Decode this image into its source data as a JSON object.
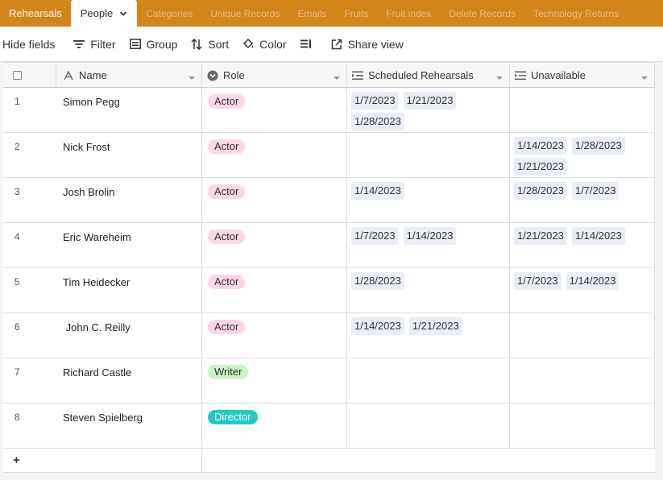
{
  "tabs": [
    {
      "label": "Rehearsals",
      "style": "first"
    },
    {
      "label": "People",
      "style": "active"
    },
    {
      "label": "Categories",
      "style": "faded"
    },
    {
      "label": "Unique Records",
      "style": "faded"
    },
    {
      "label": "Emails",
      "style": "faded"
    },
    {
      "label": "Fruits",
      "style": "faded"
    },
    {
      "label": "Fruit index",
      "style": "faded"
    },
    {
      "label": "Delete Records",
      "style": "faded"
    },
    {
      "label": "Technology Returns",
      "style": "faded"
    }
  ],
  "toolbar": {
    "hide_fields": "Hide fields",
    "filter": "Filter",
    "group": "Group",
    "sort": "Sort",
    "color": "Color",
    "share_view": "Share view"
  },
  "columns": {
    "name": "Name",
    "role": "Role",
    "scheduled": "Scheduled Rehearsals",
    "unavailable": "Unavailable"
  },
  "rows": [
    {
      "num": "1",
      "name": "Simon Pegg",
      "role": "Actor",
      "role_type": "actor",
      "scheduled": [
        "1/7/2023",
        "1/21/2023",
        "1/28/2023"
      ],
      "unavailable": []
    },
    {
      "num": "2",
      "name": "Nick Frost",
      "role": "Actor",
      "role_type": "actor",
      "scheduled": [],
      "unavailable": [
        "1/14/2023",
        "1/28/2023",
        "1/21/2023"
      ]
    },
    {
      "num": "3",
      "name": "Josh Brolin",
      "role": "Actor",
      "role_type": "actor",
      "scheduled": [
        "1/14/2023"
      ],
      "unavailable": [
        "1/28/2023",
        "1/7/2023"
      ]
    },
    {
      "num": "4",
      "name": "Eric Wareheim",
      "role": "Actor",
      "role_type": "actor",
      "scheduled": [
        "1/7/2023",
        "1/14/2023"
      ],
      "unavailable": [
        "1/21/2023",
        "1/14/2023"
      ]
    },
    {
      "num": "5",
      "name": "Tim Heidecker",
      "role": "Actor",
      "role_type": "actor",
      "scheduled": [
        "1/28/2023"
      ],
      "unavailable": [
        "1/7/2023",
        "1/14/2023"
      ]
    },
    {
      "num": "6",
      "name": " John C. Reilly",
      "role": "Actor",
      "role_type": "actor",
      "scheduled": [
        "1/14/2023",
        "1/21/2023"
      ],
      "unavailable": []
    },
    {
      "num": "7",
      "name": "Richard Castle",
      "role": "Writer",
      "role_type": "writer",
      "scheduled": [],
      "unavailable": []
    },
    {
      "num": "8",
      "name": "Steven Spielberg",
      "role": "Director",
      "role_type": "director",
      "scheduled": [],
      "unavailable": []
    }
  ],
  "add_row": "+",
  "colors": {
    "tabbar": "#d4851a",
    "actor": "#ffd6e7",
    "writer": "#c9f5c5",
    "director": "#20c9c4",
    "chip": "#e9eef6"
  }
}
